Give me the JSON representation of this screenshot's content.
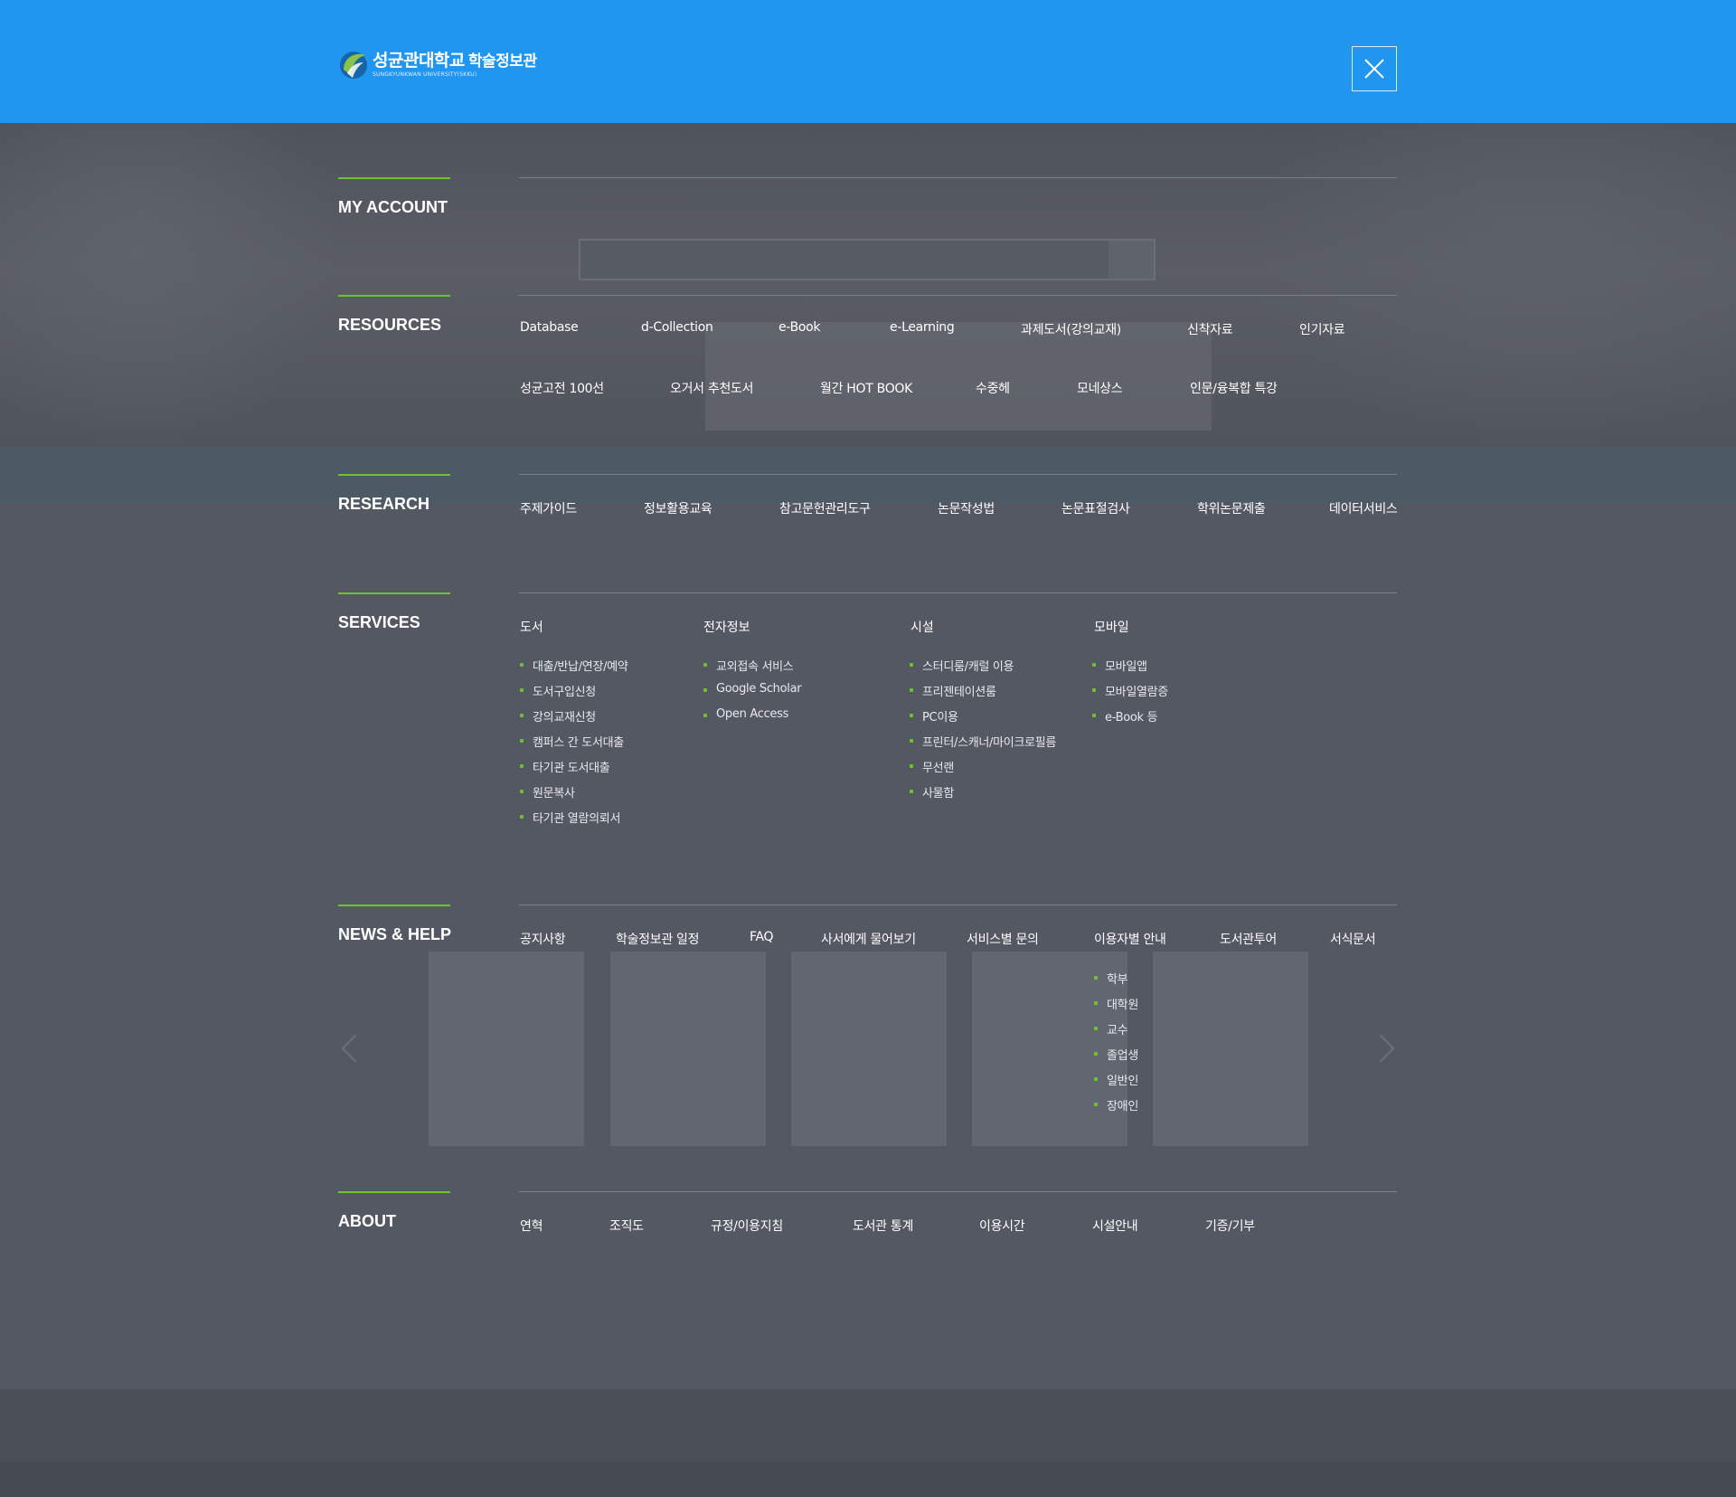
{
  "header": {
    "logo_ko": "성균관대학교",
    "logo_sub": "학술정보관",
    "logo_en": "SUNGKYUNKWAN UNIVERSITY(SKKU)",
    "close_label": "close"
  },
  "colors": {
    "header_bg": "#2196f0",
    "accent_green": "#6ec22f",
    "overlay_bg": "#545863"
  },
  "sections": {
    "my_account": {
      "title": "MY ACCOUNT"
    },
    "resources": {
      "title": "RESOURCES",
      "row1": [
        "Database",
        "d-Collection",
        "e-Book",
        "e-Learning",
        "과제도서(강의교재)",
        "신착자료",
        "인기자료"
      ],
      "row2": [
        "성균고전 100선",
        "오거서 추천도서",
        "월간 HOT BOOK",
        "수중헤",
        "모네상스",
        "인문/융복합 특강"
      ]
    },
    "research": {
      "title": "RESEARCH",
      "items": [
        "주제가이드",
        "정보활용교육",
        "참고문헌관리도구",
        "논문작성법",
        "논문표절검사",
        "학위논문제출",
        "데이터서비스"
      ]
    },
    "services": {
      "title": "SERVICES",
      "columns": [
        {
          "title": "도서",
          "items": [
            "대출/반납/연장/예약",
            "도서구입신청",
            "강의교재신청",
            "캠퍼스 간 도서대출",
            "타기관 도서대출",
            "원문복사",
            "타기관 열람의뢰서"
          ]
        },
        {
          "title": "전자정보",
          "items": [
            "교외접속 서비스",
            "Google Scholar",
            "Open Access"
          ]
        },
        {
          "title": "시설",
          "items": [
            "스터디룸/캐럴 이용",
            "프리젠테이션룸",
            "PC이용",
            "프린터/스캐너/마이크로필름",
            "무선랜",
            "사물함"
          ]
        },
        {
          "title": "모바일",
          "items": [
            "모바일앱",
            "모바일열람증",
            "e-Book 등"
          ]
        }
      ]
    },
    "news_help": {
      "title": "NEWS & HELP",
      "items": [
        "공지사항",
        "학술정보관 일정",
        "FAQ",
        "사서에게 물어보기",
        "서비스별 문의",
        "이용자별 안내",
        "도서관투어",
        "서식문서"
      ],
      "user_guide": [
        "학부",
        "대학원",
        "교수",
        "졸업생",
        "일반인",
        "장애인"
      ]
    },
    "about": {
      "title": "ABOUT",
      "items": [
        "연혁",
        "조직도",
        "규정/이용지침",
        "도서관 통계",
        "이용시간",
        "시설안내",
        "기증/기부"
      ]
    }
  }
}
